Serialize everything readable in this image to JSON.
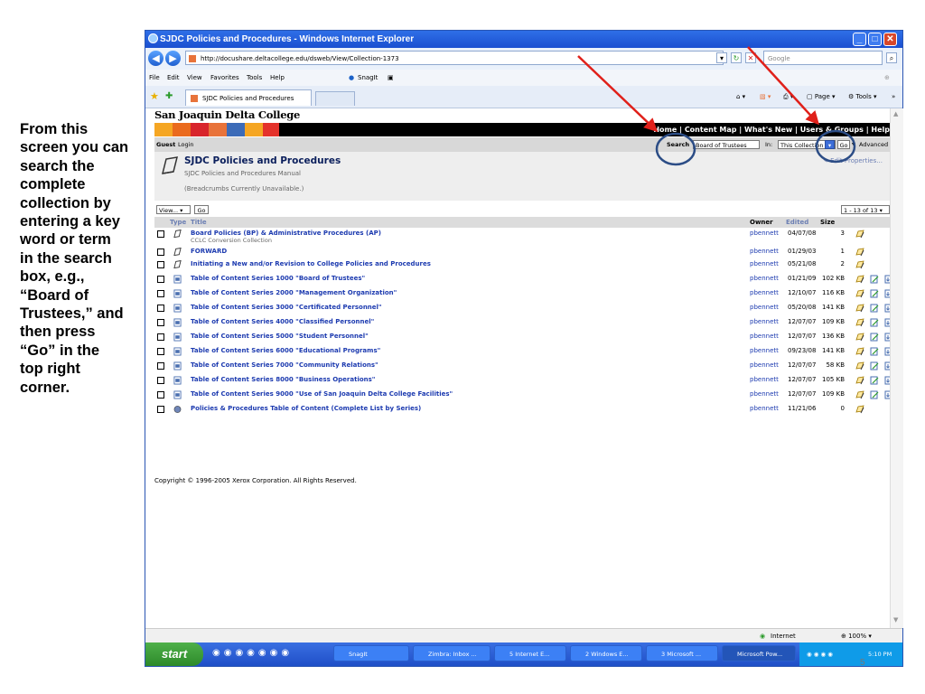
{
  "annotation": {
    "lines": [
      "From this",
      "screen you can",
      "search the",
      "complete",
      "collection by",
      "entering a key",
      "word or term",
      "in the search",
      "box, e.g.,",
      "“Board of",
      "Trustees,” and",
      "then press",
      "“Go” in the",
      "top right",
      "corner."
    ]
  },
  "browser": {
    "title": "SJDC Policies and Procedures - Windows Internet Explorer",
    "url": "http://docushare.deltacollege.edu/dsweb/View/Collection-1373",
    "search_placeholder": "Google",
    "snagit_label": "SnagIt",
    "menu": [
      "File",
      "Edit",
      "View",
      "Favorites",
      "Tools",
      "Help"
    ],
    "tab_label": "SJDC Policies and Procedures",
    "cmd_page": "Page",
    "cmd_tools": "Tools"
  },
  "site": {
    "logo": "San Joaquin Delta College",
    "topnav": [
      "Home",
      "Content Map",
      "What's New",
      "Users & Groups",
      "Help"
    ],
    "guest": "Guest",
    "login": "Login",
    "search_label": "Search",
    "search_value": "Board of Trustees",
    "in_label": "In:",
    "scope_value": "This Collection",
    "go_label": "Go",
    "advanced_label": "Advanced"
  },
  "collection": {
    "title": "SJDC Policies and Procedures",
    "subtitle": "SJDC Policies and Procedures Manual",
    "breadcrumbs": "(Breadcrumbs Currently Unavailable.)",
    "edit_props": "Edit Properties...",
    "view_label": "View...",
    "go_label": "Go",
    "pager": "1 - 13 of 13"
  },
  "list_headers": {
    "type": "Type",
    "title": "Title",
    "owner": "Owner",
    "edited": "Edited",
    "size": "Size"
  },
  "rows": [
    {
      "title": "Board Policies (BP) & Administrative Procedures (AP)",
      "sub": "CCLC Conversion Collection",
      "owner": "pbennett",
      "edited": "04/07/08",
      "size": "3",
      "kind": "folder"
    },
    {
      "title": "FORWARD",
      "sub": "",
      "owner": "pbennett",
      "edited": "01/29/03",
      "size": "1",
      "kind": "folder"
    },
    {
      "title": "Initiating a New and/or Revision to College Policies and Procedures",
      "sub": "",
      "owner": "pbennett",
      "edited": "05/21/08",
      "size": "2",
      "kind": "folder"
    },
    {
      "title": "Table of Content Series 1000 \"Board of Trustees\"",
      "sub": "",
      "owner": "pbennett",
      "edited": "01/21/09",
      "size": "102 KB",
      "kind": "doc"
    },
    {
      "title": "Table of Content Series 2000 \"Management Organization\"",
      "sub": "",
      "owner": "pbennett",
      "edited": "12/10/07",
      "size": "116 KB",
      "kind": "doc"
    },
    {
      "title": "Table of Content Series 3000 \"Certificated Personnel\"",
      "sub": "",
      "owner": "pbennett",
      "edited": "05/20/08",
      "size": "141 KB",
      "kind": "doc"
    },
    {
      "title": "Table of Content Series 4000 \"Classified Personnel\"",
      "sub": "",
      "owner": "pbennett",
      "edited": "12/07/07",
      "size": "109 KB",
      "kind": "doc"
    },
    {
      "title": "Table of Content Series 5000 \"Student Personnel\"",
      "sub": "",
      "owner": "pbennett",
      "edited": "12/07/07",
      "size": "136 KB",
      "kind": "doc"
    },
    {
      "title": "Table of Content Series 6000 \"Educational Programs\"",
      "sub": "",
      "owner": "pbennett",
      "edited": "09/23/08",
      "size": "141 KB",
      "kind": "doc"
    },
    {
      "title": "Table of Content Series 7000 \"Community Relations\"",
      "sub": "",
      "owner": "pbennett",
      "edited": "12/07/07",
      "size": "58 KB",
      "kind": "doc"
    },
    {
      "title": "Table of Content Series 8000 \"Business Operations\"",
      "sub": "",
      "owner": "pbennett",
      "edited": "12/07/07",
      "size": "105 KB",
      "kind": "doc"
    },
    {
      "title": "Table of Content Series 9000 \"Use of San Joaquin Delta College Facilities\"",
      "sub": "",
      "owner": "pbennett",
      "edited": "12/07/07",
      "size": "109 KB",
      "kind": "doc"
    },
    {
      "title": "Policies & Procedures Table of Content (Complete List by Series)",
      "sub": "",
      "owner": "pbennett",
      "edited": "11/21/06",
      "size": "0",
      "kind": "url"
    }
  ],
  "copyright": "Copyright © 1996-2005 Xerox Corporation. All Rights Reserved.",
  "status": {
    "zone": "Internet",
    "zoom": "100%"
  },
  "taskbar": {
    "start": "start",
    "items": [
      "SnagIt",
      "Zimbra: Inbox ...",
      "5 Internet E...",
      "2 Windows E...",
      "3 Microsoft ...",
      "Microsoft Pow..."
    ],
    "clock": "5:10 PM"
  },
  "slide_number": "5",
  "colors": {
    "accent_red": "#e0201a",
    "circle_blue": "#2c4d86",
    "link_blue": "#1d3bb0"
  }
}
